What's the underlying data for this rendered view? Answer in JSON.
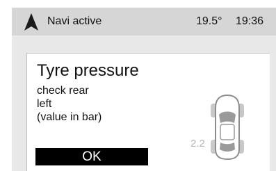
{
  "status_bar": {
    "navigation_icon": "navigation-arrow-icon",
    "navi_status": "Navi active",
    "temperature": "19.5°",
    "time": "19:36"
  },
  "dialog": {
    "title": "Tyre pressure",
    "message_lines": [
      "check rear",
      "left",
      "(value in bar)"
    ],
    "pressure_value": "2.2",
    "car_icon": "car-top-view-icon",
    "ok_label": "OK"
  },
  "colors": {
    "screen_background": "#e8e8e8",
    "status_bar_background": "#d6d6d6",
    "dialog_background": "#ffffff",
    "button_background": "#000000",
    "button_text": "#ffffff",
    "pressure_value_text": "#b5b5b5"
  }
}
